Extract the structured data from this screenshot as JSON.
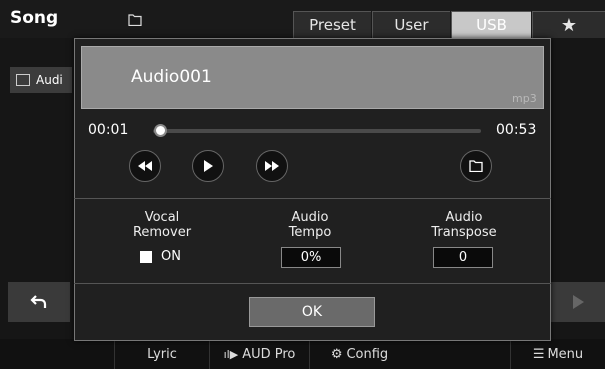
{
  "header": {
    "title": "Song",
    "tabs": [
      {
        "label": "Preset"
      },
      {
        "label": "User"
      },
      {
        "label": "USB"
      },
      {
        "label": "★"
      }
    ]
  },
  "background": {
    "list_item_label": "Audi"
  },
  "bottom_bar": {
    "items": [
      {
        "label": "Lyric"
      },
      {
        "label": "AUD Pro"
      },
      {
        "label": "Config"
      },
      {
        "label": "Menu"
      }
    ]
  },
  "dialog": {
    "file_name": "Audio001",
    "file_ext": "mp3",
    "time_current": "00:01",
    "time_total": "00:53",
    "playback_progress": 0.02,
    "params": {
      "vocal_remover": {
        "label_line1": "Vocal",
        "label_line2": "Remover",
        "state": "ON"
      },
      "audio_tempo": {
        "label_line1": "Audio",
        "label_line2": "Tempo",
        "value": "0%"
      },
      "audio_transpose": {
        "label_line1": "Audio",
        "label_line2": "Transpose",
        "value": "0"
      }
    },
    "ok_label": "OK"
  },
  "colors": {
    "active_tab": "#c8c8c8",
    "dialog_bg": "#202020",
    "name_panel": "#8a8a8a"
  }
}
